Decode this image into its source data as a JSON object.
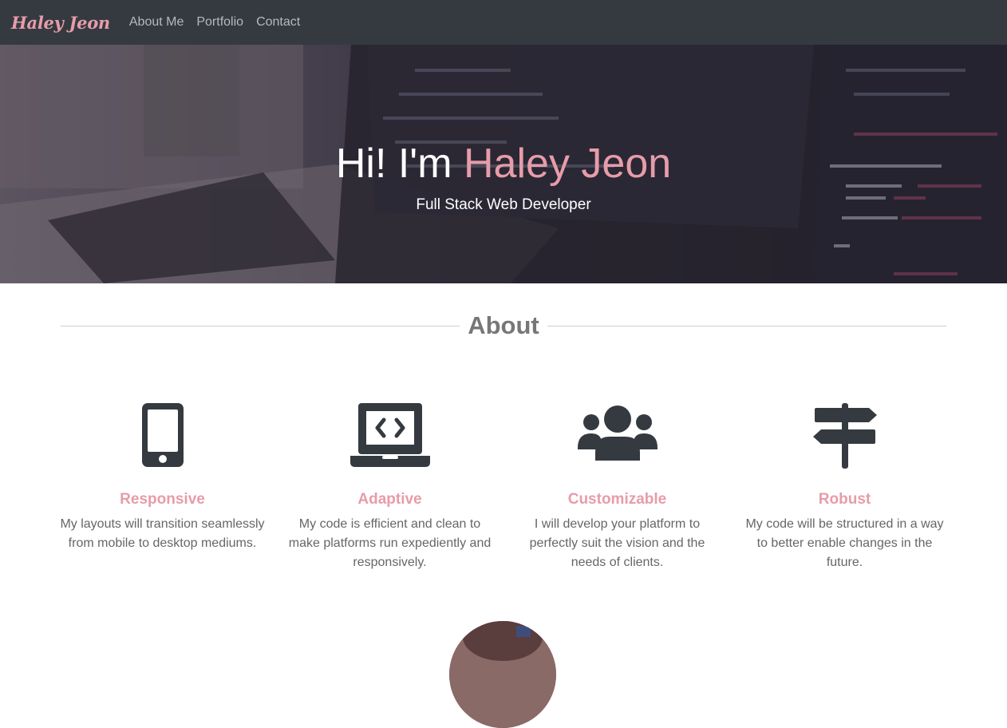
{
  "colors": {
    "accent": "#e79ca9",
    "navbar_bg": "#343a40",
    "nav_text": "#b7b9bb",
    "heading": "#777777",
    "body_text": "#666666",
    "icon": "#343a40"
  },
  "navbar": {
    "brand": "Haley Jeon",
    "links": [
      "About Me",
      "Portfolio",
      "Contact"
    ]
  },
  "hero": {
    "greeting": "Hi! I'm",
    "name": "Haley Jeon",
    "subtitle": "Full Stack Web Developer"
  },
  "about": {
    "heading": "About",
    "features": [
      {
        "icon": "mobile-phone-icon",
        "title": "Responsive",
        "text": "My layouts will transition seamlessly from mobile to desktop mediums."
      },
      {
        "icon": "laptop-code-icon",
        "title": "Adaptive",
        "text": "My code is efficient and clean to make platforms run expediently and responsively."
      },
      {
        "icon": "users-icon",
        "title": "Customizable",
        "text": "I will develop your platform to perfectly suit the vision and the needs of clients."
      },
      {
        "icon": "signpost-icon",
        "title": "Robust",
        "text": "My code will be structured in a way to better enable changes in the future."
      }
    ]
  }
}
